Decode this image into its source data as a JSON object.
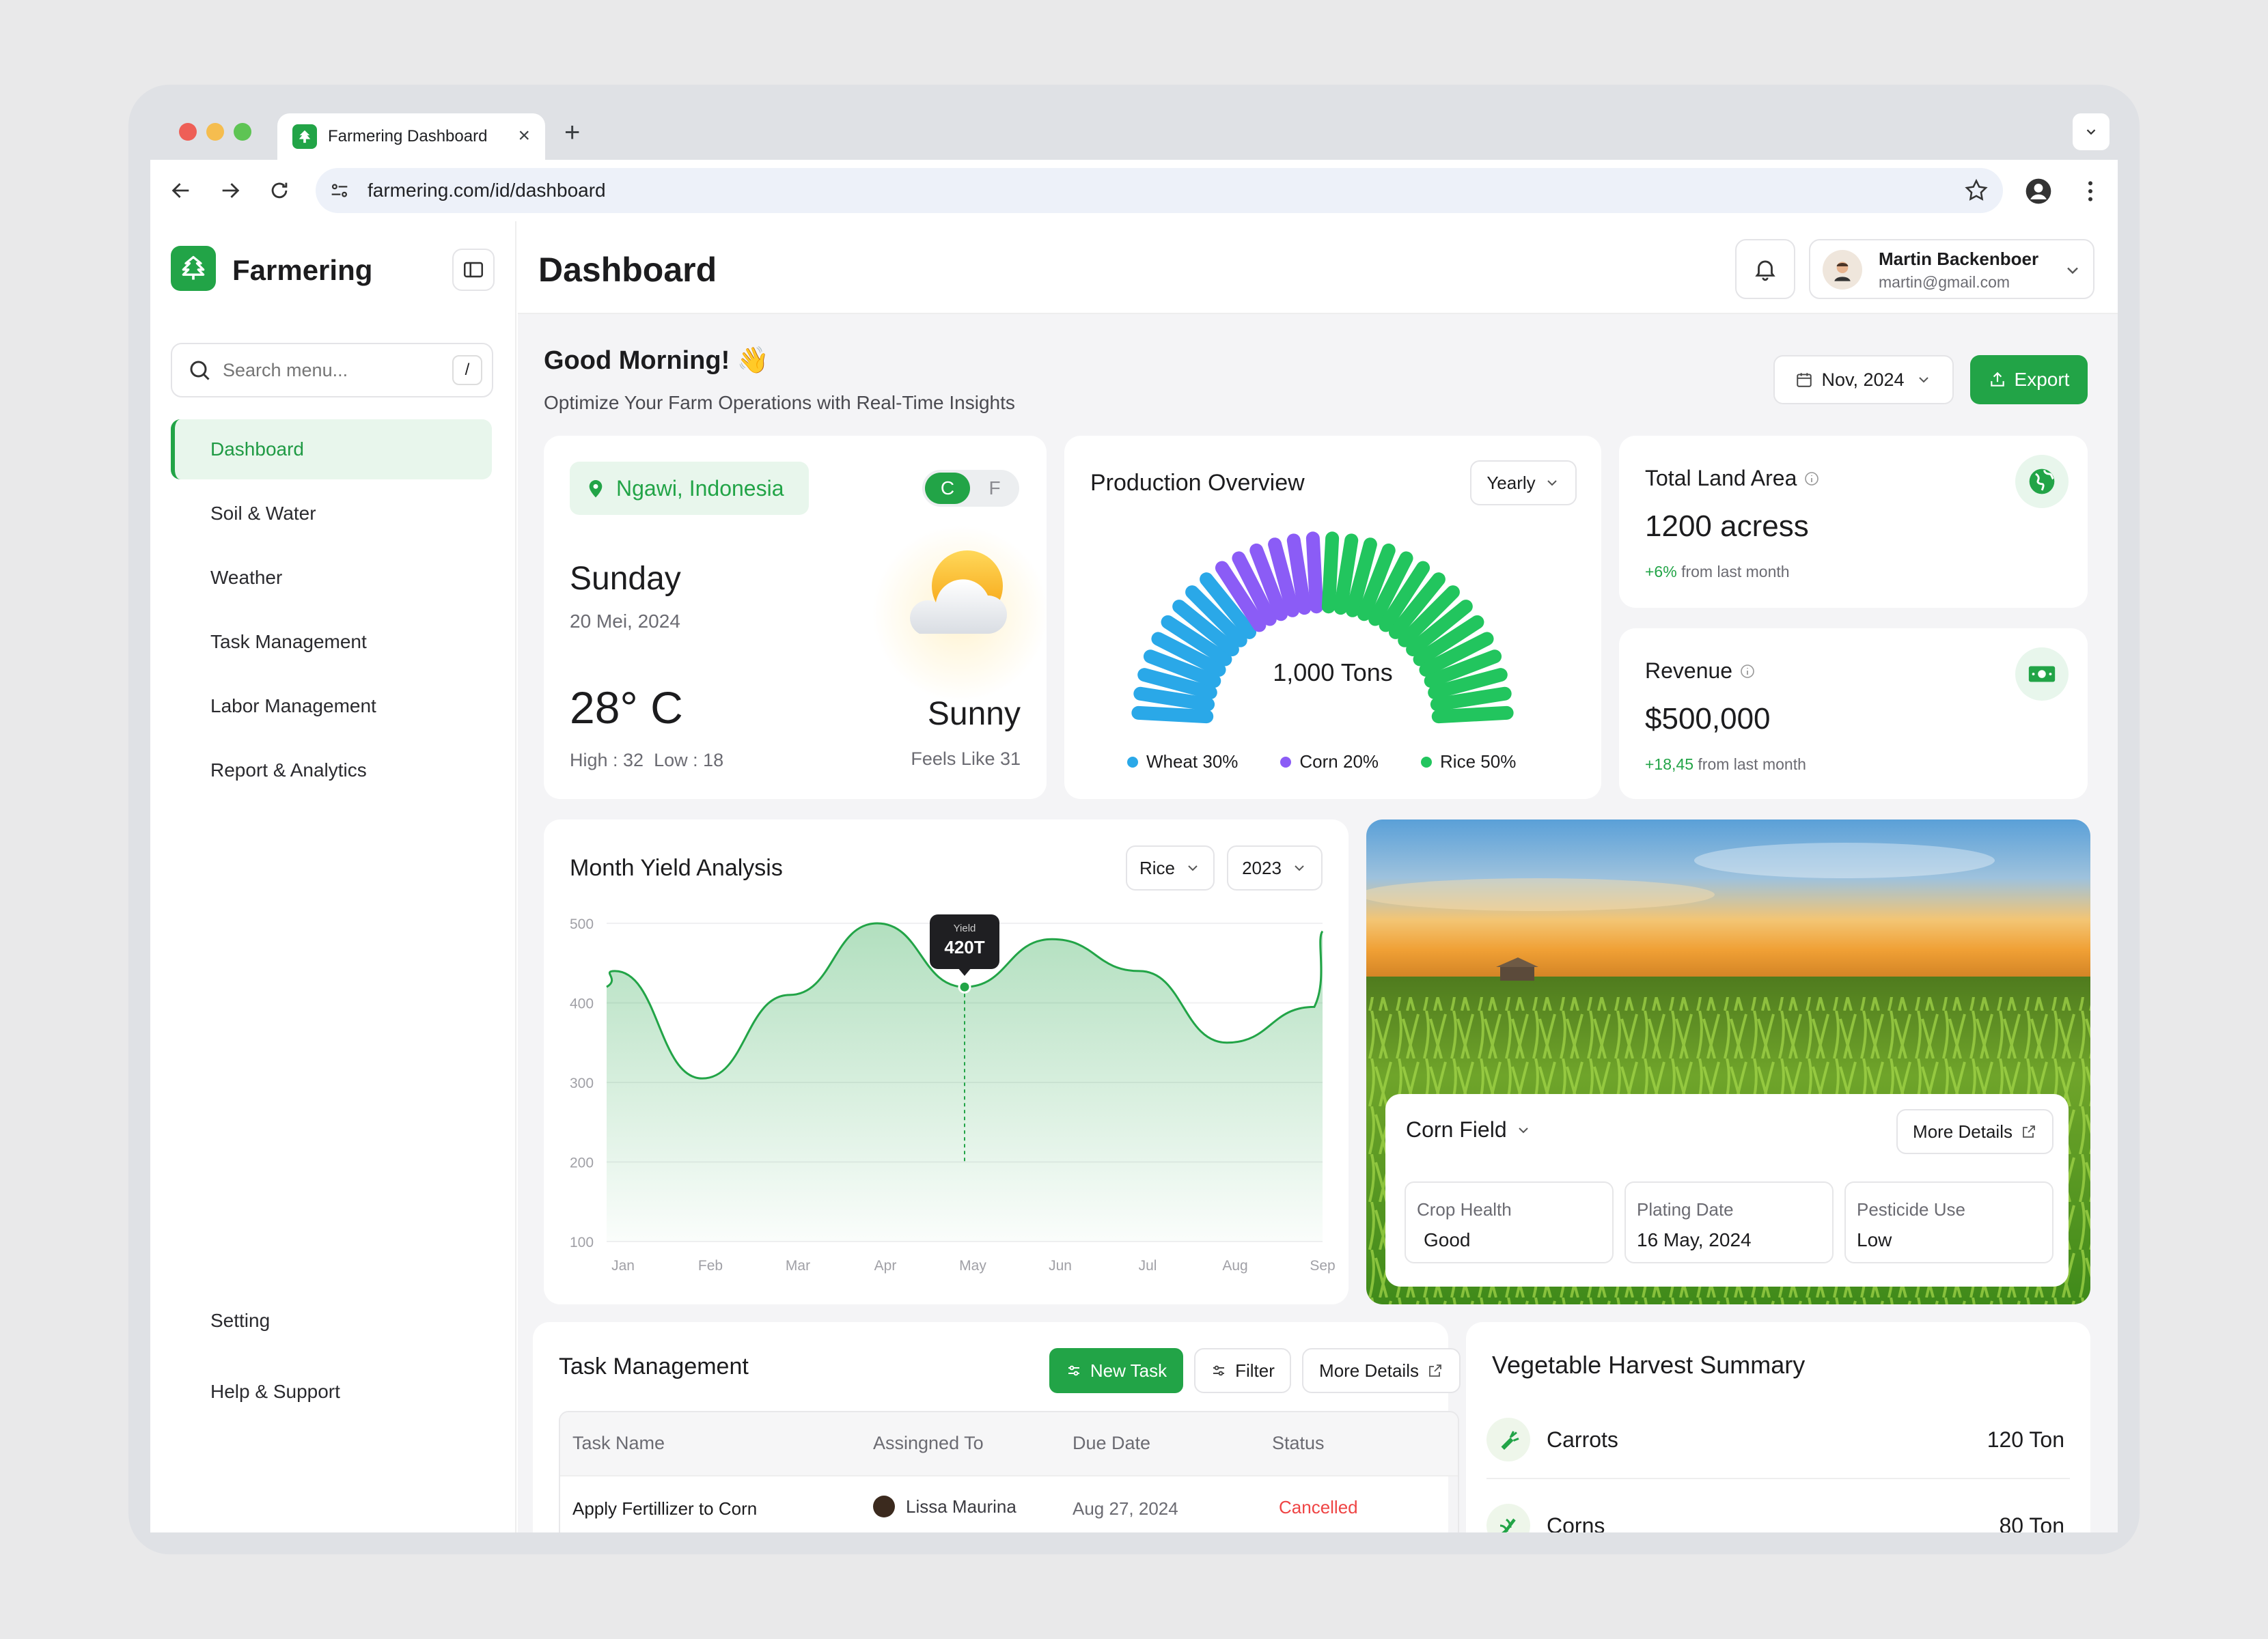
{
  "browser": {
    "tab_title": "Farmering Dashboard",
    "url": "farmering.com/id/dashboard"
  },
  "sidebar": {
    "brand": "Farmering",
    "search_placeholder": "Search menu...",
    "search_shortcut": "/",
    "items": [
      {
        "label": "Dashboard",
        "icon": "grid-icon",
        "active": true
      },
      {
        "label": "Soil & Water",
        "icon": "droplet-icon"
      },
      {
        "label": "Weather",
        "icon": "cloud-sun-icon"
      },
      {
        "label": "Task Management",
        "icon": "clipboard-icon"
      },
      {
        "label": "Labor Management",
        "icon": "folder-user-icon"
      },
      {
        "label": "Report & Analytics",
        "icon": "chart-board-icon"
      }
    ],
    "bottom": [
      {
        "label": "Setting",
        "icon": "gear-icon"
      },
      {
        "label": "Help & Support",
        "icon": "help-icon"
      }
    ]
  },
  "header": {
    "title": "Dashboard",
    "user_name": "Martin Backenboer",
    "user_email": "martin@gmail.com"
  },
  "greeting": {
    "title": "Good Morning! 👋",
    "subtitle": "Optimize Your Farm Operations with Real-Time Insights",
    "date_filter": "Nov, 2024",
    "export_label": "Export"
  },
  "weather": {
    "location": "Ngawi, Indonesia",
    "unit_c": "C",
    "unit_f": "F",
    "day": "Sunday",
    "date": "20 Mei, 2024",
    "temp": "28° C",
    "high_low": "High : 32  Low : 18",
    "condition": "Sunny",
    "feels_like": "Feels Like 31"
  },
  "production": {
    "title": "Production Overview",
    "period": "Yearly",
    "total": "1,000 Tons",
    "legend": [
      {
        "label": "Wheat 30%",
        "color": "#2aa8e8",
        "share": 30
      },
      {
        "label": "Corn 20%",
        "color": "#8b5cf6",
        "share": 20
      },
      {
        "label": "Rice 50%",
        "color": "#22c55e",
        "share": 50
      }
    ]
  },
  "land": {
    "title": "Total Land Area",
    "value": "1200 acress",
    "change": "+6%",
    "change_text": "from last month"
  },
  "revenue": {
    "title": "Revenue",
    "value": "$500,000",
    "change": "+18,45",
    "change_text": "from last month"
  },
  "yield": {
    "title": "Month Yield Analysis",
    "crop": "Rice",
    "year": "2023",
    "tooltip_label": "Yield",
    "tooltip_value": "420T"
  },
  "chart_data": {
    "type": "area",
    "title": "Month Yield Analysis",
    "x": [
      "Jan",
      "Feb",
      "Mar",
      "Apr",
      "May",
      "Jun",
      "Jul",
      "Aug",
      "Sep"
    ],
    "yticks": [
      500,
      400,
      300,
      200,
      100
    ],
    "ylim": [
      100,
      500
    ],
    "series": [
      {
        "values": [
          440,
          305,
          410,
          500,
          420,
          480,
          440,
          350,
          395
        ]
      }
    ],
    "highlight": {
      "x": "May",
      "value": 420
    }
  },
  "field": {
    "name": "Corn Field",
    "more": "More Details",
    "stats": [
      {
        "label": "Crop Health",
        "value": "Good"
      },
      {
        "label": "Plating Date",
        "value": "16 May, 2024"
      },
      {
        "label": "Pesticide Use",
        "value": "Low"
      }
    ]
  },
  "tasks": {
    "title": "Task Management",
    "new_task": "New Task",
    "filter": "Filter",
    "more": "More Details",
    "columns": [
      "Task Name",
      "Assingned To",
      "Due Date",
      "Status"
    ],
    "rows": [
      {
        "name": "Apply Fertillizer to Corn",
        "assignee": "Lissa Maurina",
        "due": "Aug 27, 2024",
        "status": "Cancelled"
      }
    ]
  },
  "harvest": {
    "title": "Vegetable Harvest Summary",
    "items": [
      {
        "name": "Carrots",
        "value": "120 Ton"
      },
      {
        "name": "Corns",
        "value": "80 Ton"
      }
    ]
  }
}
